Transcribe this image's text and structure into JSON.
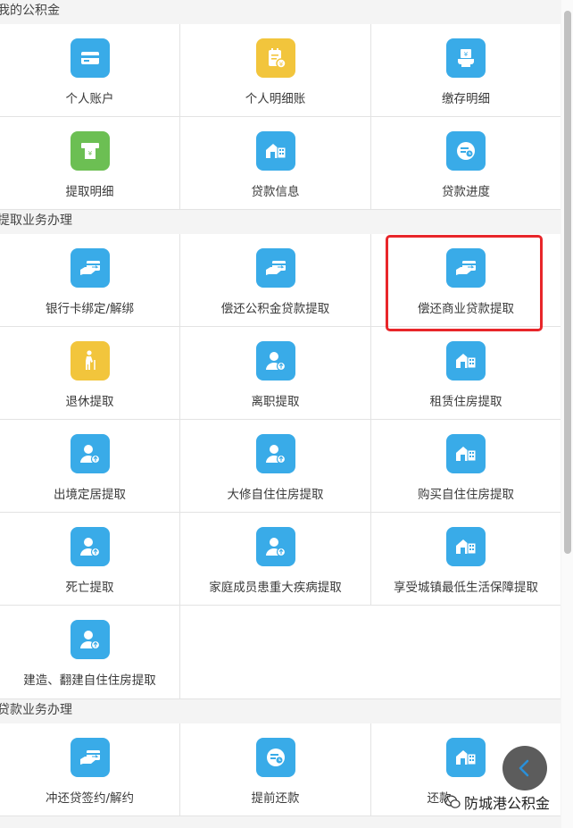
{
  "sections": [
    {
      "title": "我的公积金",
      "items": [
        {
          "label": "个人账户",
          "icon": "card-icon",
          "color": "blue"
        },
        {
          "label": "个人明细账",
          "icon": "ledger-icon",
          "color": "yellow"
        },
        {
          "label": "缴存明细",
          "icon": "deposit-icon",
          "color": "blue"
        },
        {
          "label": "提取明细",
          "icon": "atm-withdraw-icon",
          "color": "green"
        },
        {
          "label": "贷款信息",
          "icon": "house-icon",
          "color": "blue"
        },
        {
          "label": "贷款进度",
          "icon": "progress-icon",
          "color": "blue"
        }
      ]
    },
    {
      "title": "提取业务办理",
      "items": [
        {
          "label": "银行卡绑定/解绑",
          "icon": "card-hand-icon",
          "color": "blue"
        },
        {
          "label": "偿还公积金贷款提取",
          "icon": "card-hand-icon",
          "color": "blue"
        },
        {
          "label": "偿还商业贷款提取",
          "icon": "card-hand-icon",
          "color": "blue"
        },
        {
          "label": "退休提取",
          "icon": "elderly-icon",
          "color": "yellow"
        },
        {
          "label": "离职提取",
          "icon": "person-up-icon",
          "color": "blue"
        },
        {
          "label": "租赁住房提取",
          "icon": "house-icon",
          "color": "blue"
        },
        {
          "label": "出境定居提取",
          "icon": "person-up-icon",
          "color": "blue"
        },
        {
          "label": "大修自住住房提取",
          "icon": "person-up-icon",
          "color": "blue"
        },
        {
          "label": "购买自住住房提取",
          "icon": "house-icon",
          "color": "blue"
        },
        {
          "label": "死亡提取",
          "icon": "person-up-icon",
          "color": "blue"
        },
        {
          "label": "家庭成员患重大疾病提取",
          "icon": "person-up-icon",
          "color": "blue"
        },
        {
          "label": "享受城镇最低生活保障提取",
          "icon": "house-icon",
          "color": "blue"
        },
        {
          "label": "建造、翻建自住住房提取",
          "icon": "person-up-icon",
          "color": "blue"
        }
      ]
    },
    {
      "title": "贷款业务办理",
      "items": [
        {
          "label": "冲还贷签约/解约",
          "icon": "card-hand-icon",
          "color": "blue"
        },
        {
          "label": "提前还款",
          "icon": "progress-icon",
          "color": "blue"
        },
        {
          "label": "还款",
          "icon": "house-icon",
          "color": "blue"
        }
      ]
    }
  ],
  "watermark": "防城港公积金",
  "back_button_icon": "chevron-left-icon",
  "colors": {
    "blue": "#39abe8",
    "yellow": "#f2c53c",
    "green": "#6cbf53",
    "highlight": "#e8262a"
  }
}
